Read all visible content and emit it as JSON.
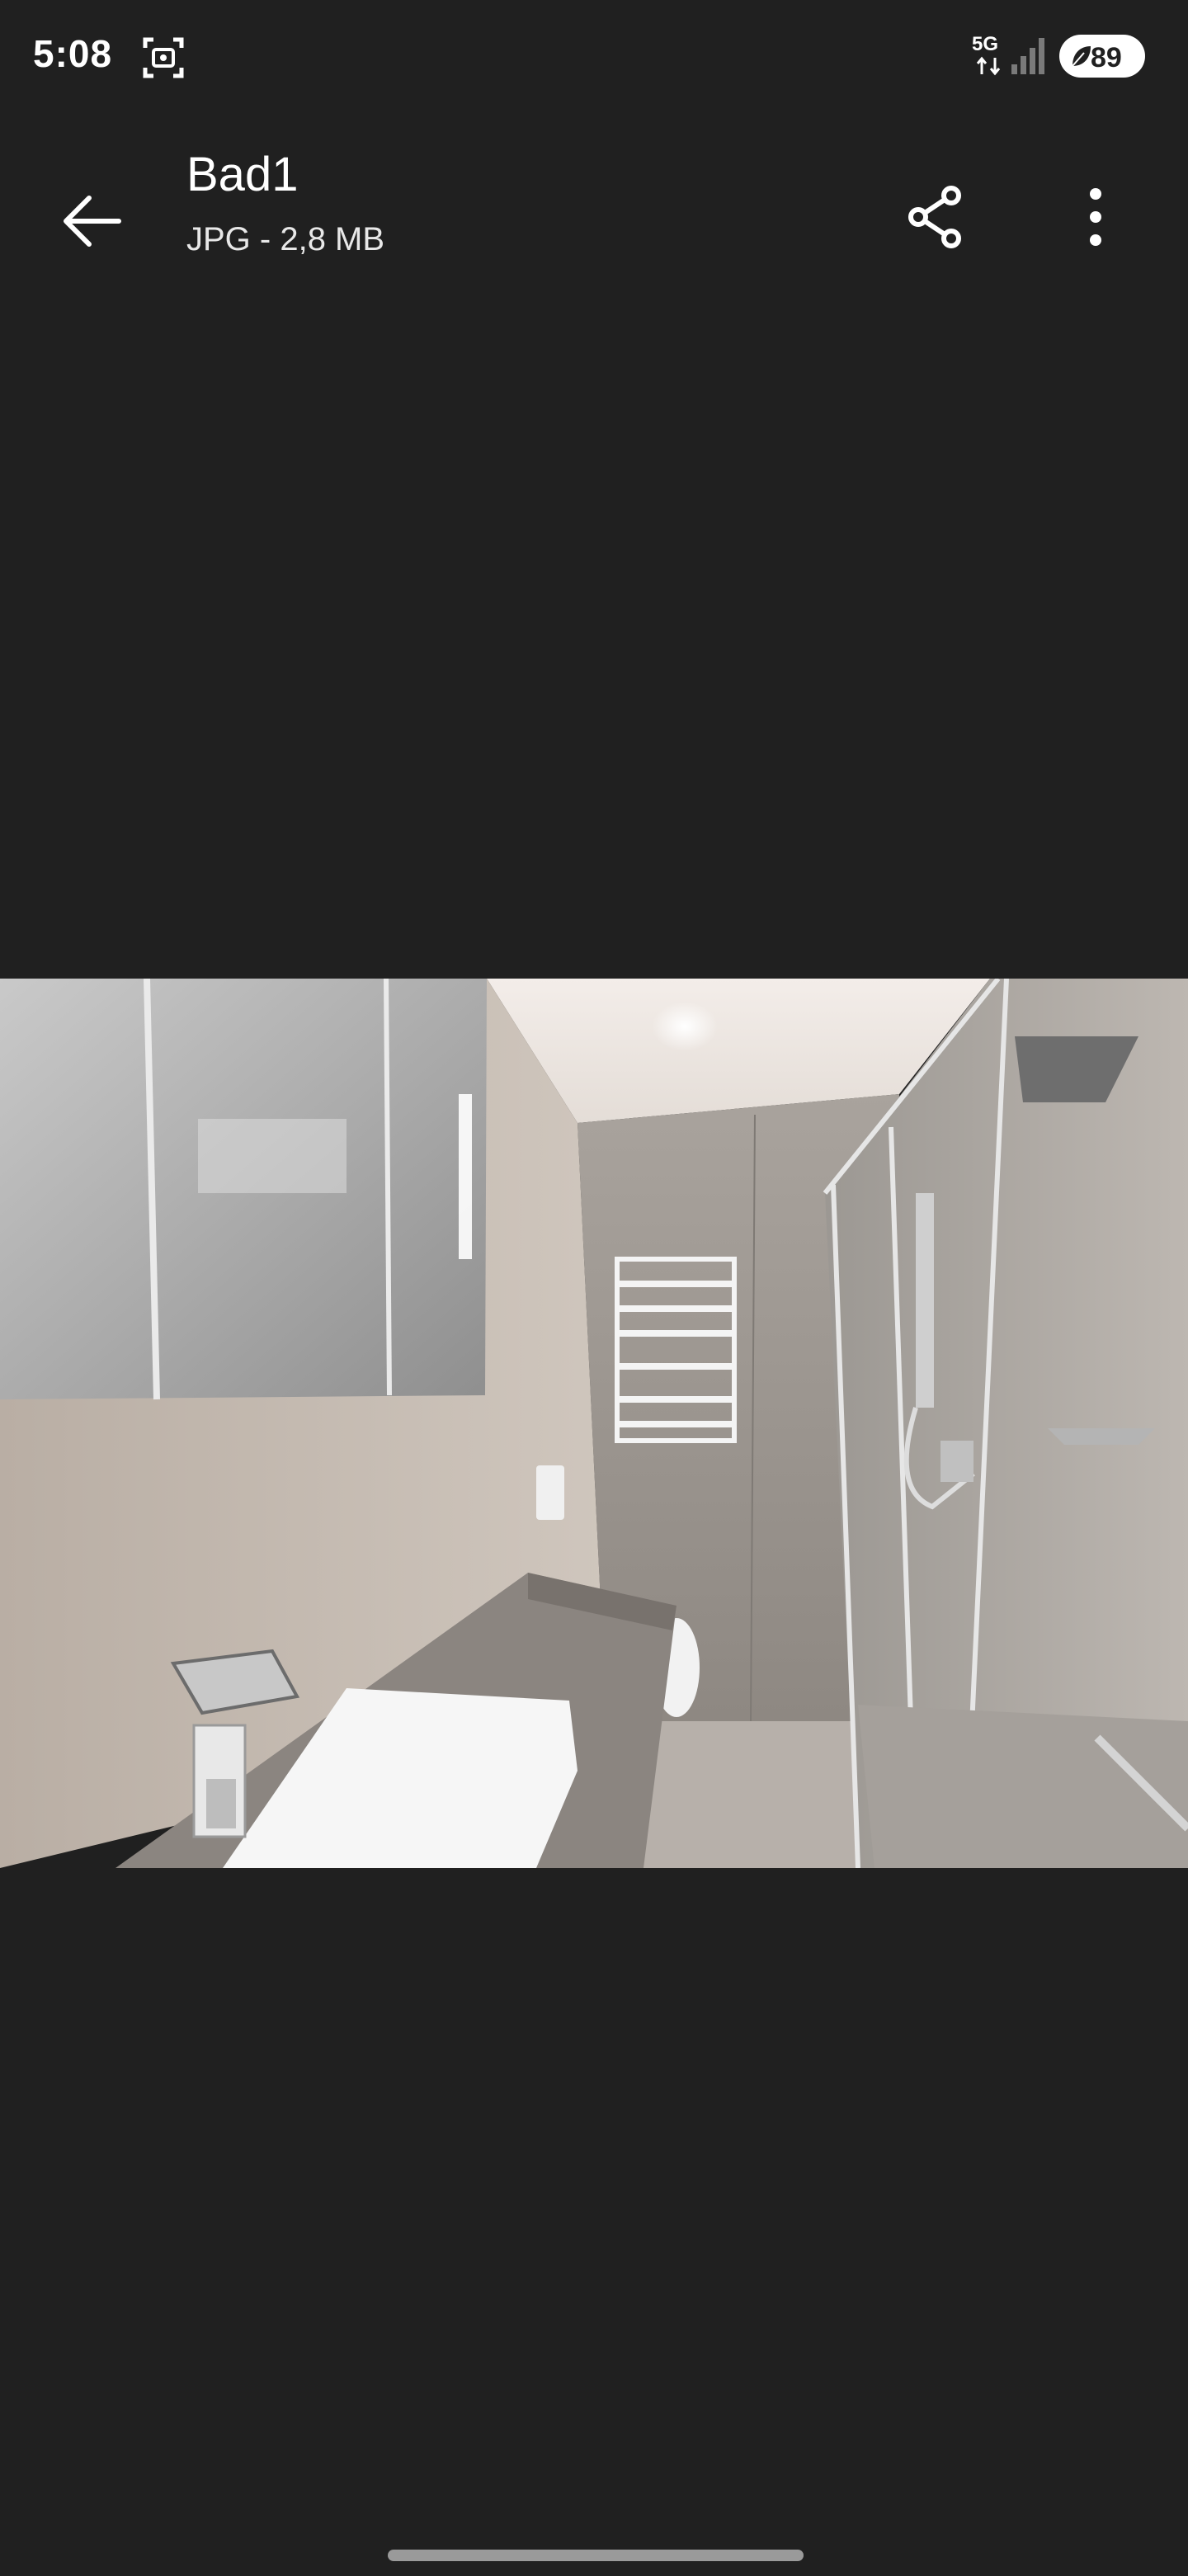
{
  "status_bar": {
    "time": "5:08",
    "network": "5G",
    "battery": "89",
    "icons": [
      "screenshot-icon",
      "5g-icon",
      "signal-icon",
      "battery-icon"
    ]
  },
  "app_bar": {
    "title": "Bad1",
    "subtitle": "JPG - 2,8 MB",
    "icons": [
      "back-arrow-icon",
      "share-icon",
      "more-vert-icon"
    ]
  },
  "colors": {
    "background": "#202020",
    "text": "#ffffff"
  }
}
